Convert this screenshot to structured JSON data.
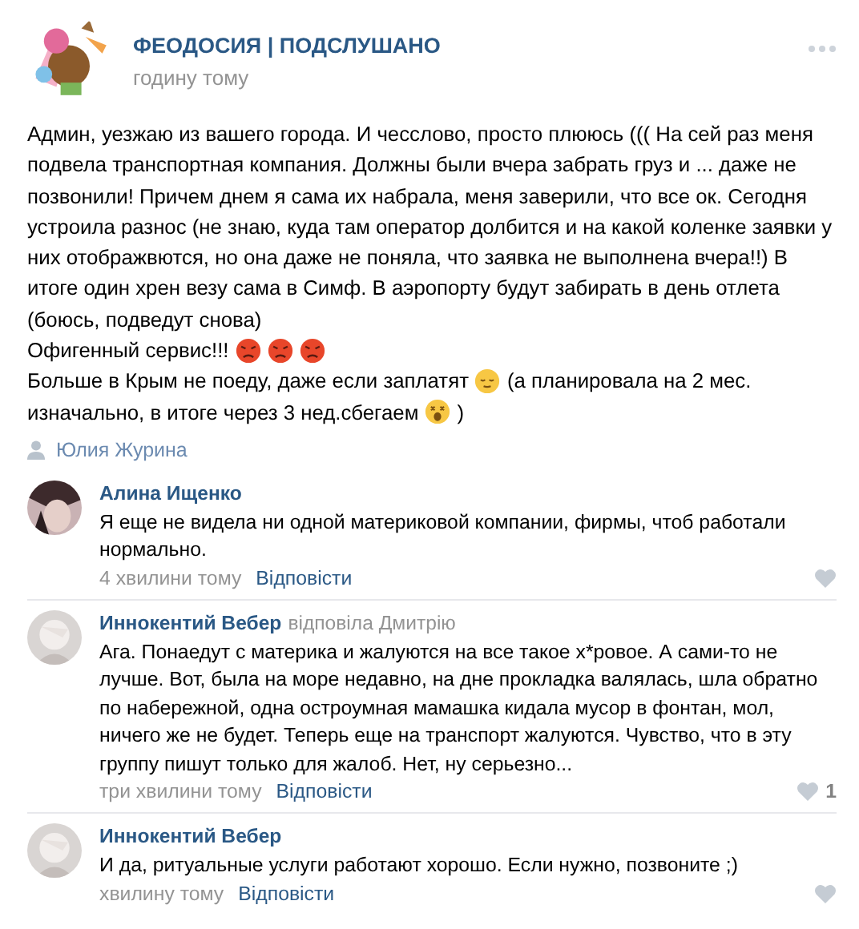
{
  "post": {
    "group_name": "ФЕОДОСИЯ | ПОДСЛУШАНО",
    "time": "годину тому",
    "text": "Админ, уезжаю из вашего города. И чесслово, просто плююсь ((( На сей раз меня подвела транспортная компания. Должны были вчера забрать груз и ... даже не позвонили! Причем днем я сама их набрала, меня заверили, что все ок. Сегодня устроила разнос (не знаю, куда там оператор долбится и на какой коленке заявки у них отображвются, но она даже не поняла, что заявка не выполнена вчера!!) В итоге один хрен везу сама в Симф. В аэропорту будут забирать в день отлета (боюсь, подведут снова)",
    "lines": [
      [
        {
          "kind": "text",
          "text": "Офигенный сервис!!!"
        },
        {
          "kind": "angry"
        },
        {
          "kind": "angry"
        },
        {
          "kind": "angry"
        }
      ],
      [
        {
          "kind": "text",
          "text": "Больше в Крым не поеду, даже если заплатят"
        },
        {
          "kind": "relieved"
        },
        {
          "kind": "text",
          "text": "(а планировала на 2 мес."
        }
      ],
      [
        {
          "kind": "text",
          "text": "изначально, в итоге через 3 нед.сбегаем"
        },
        {
          "kind": "astonished"
        },
        {
          "kind": "text",
          "text": ")"
        }
      ]
    ],
    "author": "Юлия Журина"
  },
  "comments": [
    {
      "name": "Алина Ищенко",
      "text": "Я еще не видела ни одной материковой компании, фирмы, чтоб работали нормально.",
      "time": "4 хвилини тому",
      "reply": "Відповісти"
    },
    {
      "name": "Иннокентий Вебер",
      "reply_to": "відповіла Дмитрію",
      "text": "Ага. Понаедут с материка и жалуются на все такое х*ровое. А сами-то не лучше. Вот, была на море недавно, на дне прокладка валялась, шла обратно по набережной, одна остроумная мамашка кидала мусор в фонтан, мол, ничего же не будет. Теперь еще на транспорт жалуются. Чувство, что в эту группу пишут только для жалоб. Нет, ну серьезно...",
      "time": "три хвилини тому",
      "reply": "Відповісти",
      "likes": "1"
    },
    {
      "name": "Иннокентий Вебер",
      "text": "И да, ритуальные услуги работают хорошо. Если нужно, позвоните ;)",
      "time": "хвилину тому",
      "reply": "Відповісти"
    }
  ]
}
